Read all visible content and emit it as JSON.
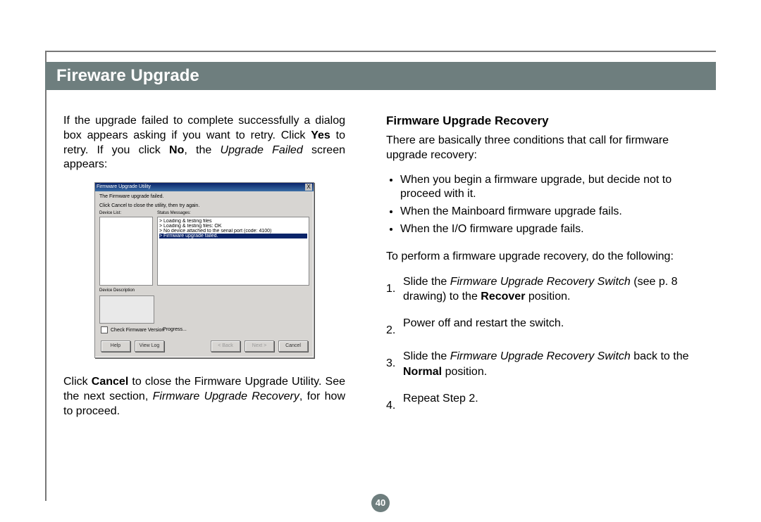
{
  "header": {
    "title": "Fireware Upgrade"
  },
  "left": {
    "p1_part1": "If the upgrade failed to complete successfully a dialog box appears asking if you want to retry. Click ",
    "p1_yes": "Yes",
    "p1_mid": " to retry. If you click ",
    "p1_no": "No",
    "p1_mid2": ", the ",
    "p1_italic": "Upgrade Failed",
    "p1_end": " screen appears:",
    "p2_a": "Click ",
    "p2_cancel": "Cancel",
    "p2_b": " to close the Firmware Upgrade Utility. See the next section, ",
    "p2_italic": "Firmware Upgrade Recovery",
    "p2_c": ", for how to proceed."
  },
  "shot": {
    "title": "Firmware Upgrade Utility",
    "x": "X",
    "fail": "The Firmware upgrade failed.",
    "hint": "Click Cancel to close the utility, then try again.",
    "lbl_dev": "Device List:",
    "lbl_status": "Status Messages:",
    "s1": "> Loading & testing files",
    "s2": "> Loading & testing files: OK",
    "s3": "> No device attached to the serial port (code: 4100)",
    "s4": "> Firmware upgrade failed.",
    "lbl_desc": "Device Description",
    "check": "Check Firmware Version",
    "progress": "Progress...",
    "b_help": "Help",
    "b_vlog": "View Log",
    "b_back": "< Back",
    "b_next": "Next >",
    "b_cancel": "Cancel"
  },
  "right": {
    "subhead": "Firmware Upgrade Recovery",
    "intro": "There are basically three conditions that call for firmware upgrade recovery:",
    "bul1": "When you begin a firmware upgrade, but decide not to proceed with it.",
    "bul2": "When the Mainboard firmware upgrade fails.",
    "bul3": "When the I/O firmware upgrade fails.",
    "p2": "To perform a firmware upgrade recovery, do the following:",
    "n1": "1.",
    "n2": "2.",
    "n3": "3.",
    "n4": "4.",
    "o1_a": "Slide the ",
    "o1_i": "Firmware Upgrade Recovery Switch",
    "o1_b": " (see p. 8 drawing) to the ",
    "o1_bold": "Recover",
    "o1_c": " position.",
    "o2": "Power off and restart the switch.",
    "o3_a": "Slide the ",
    "o3_i": "Firmware Upgrade Recovery Switch",
    "o3_b": " back to the ",
    "o3_bold": "Normal",
    "o3_c": " position.",
    "o4": "Repeat Step 2."
  },
  "page": {
    "num": "40"
  }
}
